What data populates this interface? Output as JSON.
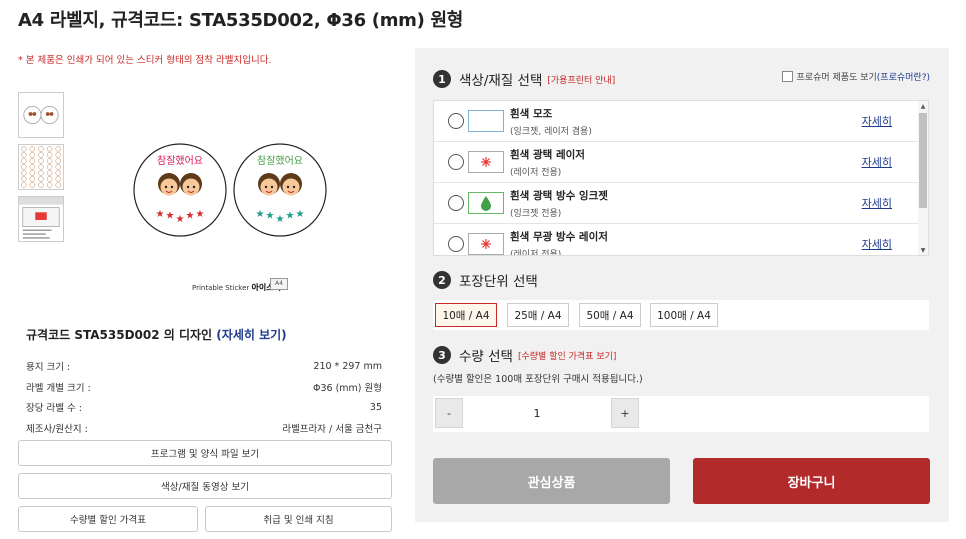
{
  "page": {
    "title": "A4 라벨지, 규격코드: STA535D002, Φ36 (mm) 원형",
    "notice": "* 본 제품은 인쇄가 되어 있는 스티커 형태의 점착 라벨지입니다."
  },
  "preview": {
    "brand_small": "Printable Sticker",
    "brand_name": "아이스틱",
    "brand_sheet": "A4",
    "label_text": "참잘했어요"
  },
  "design": {
    "title_prefix": "규격코드 STA535D002 의 디자인",
    "title_link": "(자세히 보기)"
  },
  "specs": [
    {
      "label": "용지 크기 :",
      "value": "210 * 297 mm"
    },
    {
      "label": "라벨 개별 크기 :",
      "value": "Φ36 (mm) 원형"
    },
    {
      "label": "장당 라벨 수 :",
      "value": "35"
    },
    {
      "label": "제조사/원산지 :",
      "value": "라벨프라자 / 서울 금천구"
    }
  ],
  "left_buttons": {
    "program": "프로그램 및 양식 파일 보기",
    "video": "색상/재질 동영상 보기",
    "price_table": "수량별 할인 가격표",
    "handling": "취급 및 인쇄 지침"
  },
  "step1": {
    "num": "1",
    "title": "색상/재질 선택",
    "sub": "[가용프린터 안내]",
    "pro_label": "프로슈머 제품도 보기",
    "pro_link": "(프로슈머란?)",
    "materials": [
      {
        "name": "흰색 모조",
        "desc": "(잉크젯, 레이저 겸용)",
        "link": "자세히",
        "icon": "plain-swatch"
      },
      {
        "name": "흰색 광택 레이저",
        "desc": "(레이저 전용)",
        "link": "자세히",
        "icon": "laser-swatch"
      },
      {
        "name": "흰색 광택 방수 잉크젯",
        "desc": "(잉크젯 전용)",
        "link": "자세히",
        "icon": "waterdrop-swatch"
      },
      {
        "name": "흰색 무광 방수 레이저",
        "desc": "(레이저 전용)",
        "link": "자세히",
        "icon": "laser-swatch"
      }
    ]
  },
  "step2": {
    "num": "2",
    "title": "포장단위 선택",
    "options": [
      "10매 / A4",
      "25매 / A4",
      "50매 / A4",
      "100매 / A4"
    ],
    "selected": "10매 / A4"
  },
  "step3": {
    "num": "3",
    "title": "수량 선택",
    "sub": "[수량별 할인 가격표 보기]",
    "note": "(수량별 할인은 100매 포장단위 구매시 적용됩니다.)",
    "minus": "-",
    "plus": "+",
    "quantity": "1"
  },
  "actions": {
    "wishlist": "관심상품",
    "cart": "장바구니"
  },
  "colors": {
    "accent_red": "#b22a2a",
    "link_blue": "#1f3b8a",
    "notice_red": "#c62828",
    "star_red": "#d32f2f",
    "star_teal": "#1e9e8e"
  }
}
